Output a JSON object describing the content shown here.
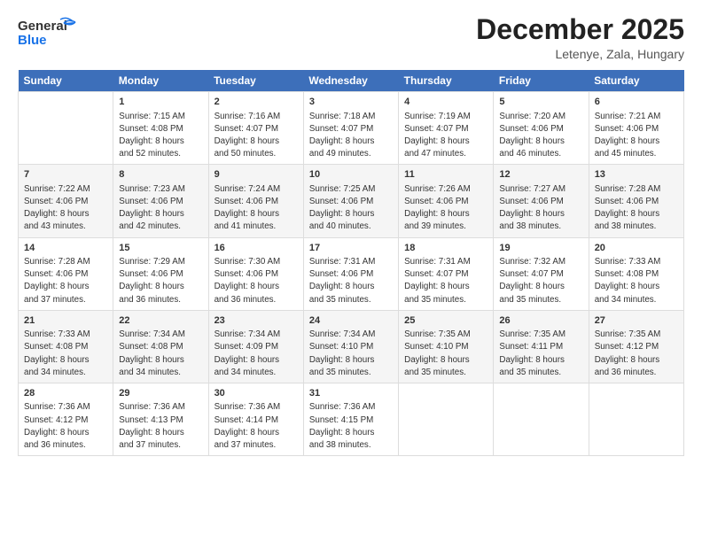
{
  "logo": {
    "line1": "General",
    "line2": "Blue"
  },
  "header": {
    "month": "December 2025",
    "location": "Letenye, Zala, Hungary"
  },
  "days_of_week": [
    "Sunday",
    "Monday",
    "Tuesday",
    "Wednesday",
    "Thursday",
    "Friday",
    "Saturday"
  ],
  "weeks": [
    [
      {
        "day": "",
        "content": ""
      },
      {
        "day": "1",
        "content": "Sunrise: 7:15 AM\nSunset: 4:08 PM\nDaylight: 8 hours\nand 52 minutes."
      },
      {
        "day": "2",
        "content": "Sunrise: 7:16 AM\nSunset: 4:07 PM\nDaylight: 8 hours\nand 50 minutes."
      },
      {
        "day": "3",
        "content": "Sunrise: 7:18 AM\nSunset: 4:07 PM\nDaylight: 8 hours\nand 49 minutes."
      },
      {
        "day": "4",
        "content": "Sunrise: 7:19 AM\nSunset: 4:07 PM\nDaylight: 8 hours\nand 47 minutes."
      },
      {
        "day": "5",
        "content": "Sunrise: 7:20 AM\nSunset: 4:06 PM\nDaylight: 8 hours\nand 46 minutes."
      },
      {
        "day": "6",
        "content": "Sunrise: 7:21 AM\nSunset: 4:06 PM\nDaylight: 8 hours\nand 45 minutes."
      }
    ],
    [
      {
        "day": "7",
        "content": "Sunrise: 7:22 AM\nSunset: 4:06 PM\nDaylight: 8 hours\nand 43 minutes."
      },
      {
        "day": "8",
        "content": "Sunrise: 7:23 AM\nSunset: 4:06 PM\nDaylight: 8 hours\nand 42 minutes."
      },
      {
        "day": "9",
        "content": "Sunrise: 7:24 AM\nSunset: 4:06 PM\nDaylight: 8 hours\nand 41 minutes."
      },
      {
        "day": "10",
        "content": "Sunrise: 7:25 AM\nSunset: 4:06 PM\nDaylight: 8 hours\nand 40 minutes."
      },
      {
        "day": "11",
        "content": "Sunrise: 7:26 AM\nSunset: 4:06 PM\nDaylight: 8 hours\nand 39 minutes."
      },
      {
        "day": "12",
        "content": "Sunrise: 7:27 AM\nSunset: 4:06 PM\nDaylight: 8 hours\nand 38 minutes."
      },
      {
        "day": "13",
        "content": "Sunrise: 7:28 AM\nSunset: 4:06 PM\nDaylight: 8 hours\nand 38 minutes."
      }
    ],
    [
      {
        "day": "14",
        "content": "Sunrise: 7:28 AM\nSunset: 4:06 PM\nDaylight: 8 hours\nand 37 minutes."
      },
      {
        "day": "15",
        "content": "Sunrise: 7:29 AM\nSunset: 4:06 PM\nDaylight: 8 hours\nand 36 minutes."
      },
      {
        "day": "16",
        "content": "Sunrise: 7:30 AM\nSunset: 4:06 PM\nDaylight: 8 hours\nand 36 minutes."
      },
      {
        "day": "17",
        "content": "Sunrise: 7:31 AM\nSunset: 4:06 PM\nDaylight: 8 hours\nand 35 minutes."
      },
      {
        "day": "18",
        "content": "Sunrise: 7:31 AM\nSunset: 4:07 PM\nDaylight: 8 hours\nand 35 minutes."
      },
      {
        "day": "19",
        "content": "Sunrise: 7:32 AM\nSunset: 4:07 PM\nDaylight: 8 hours\nand 35 minutes."
      },
      {
        "day": "20",
        "content": "Sunrise: 7:33 AM\nSunset: 4:08 PM\nDaylight: 8 hours\nand 34 minutes."
      }
    ],
    [
      {
        "day": "21",
        "content": "Sunrise: 7:33 AM\nSunset: 4:08 PM\nDaylight: 8 hours\nand 34 minutes."
      },
      {
        "day": "22",
        "content": "Sunrise: 7:34 AM\nSunset: 4:08 PM\nDaylight: 8 hours\nand 34 minutes."
      },
      {
        "day": "23",
        "content": "Sunrise: 7:34 AM\nSunset: 4:09 PM\nDaylight: 8 hours\nand 34 minutes."
      },
      {
        "day": "24",
        "content": "Sunrise: 7:34 AM\nSunset: 4:10 PM\nDaylight: 8 hours\nand 35 minutes."
      },
      {
        "day": "25",
        "content": "Sunrise: 7:35 AM\nSunset: 4:10 PM\nDaylight: 8 hours\nand 35 minutes."
      },
      {
        "day": "26",
        "content": "Sunrise: 7:35 AM\nSunset: 4:11 PM\nDaylight: 8 hours\nand 35 minutes."
      },
      {
        "day": "27",
        "content": "Sunrise: 7:35 AM\nSunset: 4:12 PM\nDaylight: 8 hours\nand 36 minutes."
      }
    ],
    [
      {
        "day": "28",
        "content": "Sunrise: 7:36 AM\nSunset: 4:12 PM\nDaylight: 8 hours\nand 36 minutes."
      },
      {
        "day": "29",
        "content": "Sunrise: 7:36 AM\nSunset: 4:13 PM\nDaylight: 8 hours\nand 37 minutes."
      },
      {
        "day": "30",
        "content": "Sunrise: 7:36 AM\nSunset: 4:14 PM\nDaylight: 8 hours\nand 37 minutes."
      },
      {
        "day": "31",
        "content": "Sunrise: 7:36 AM\nSunset: 4:15 PM\nDaylight: 8 hours\nand 38 minutes."
      },
      {
        "day": "",
        "content": ""
      },
      {
        "day": "",
        "content": ""
      },
      {
        "day": "",
        "content": ""
      }
    ]
  ]
}
